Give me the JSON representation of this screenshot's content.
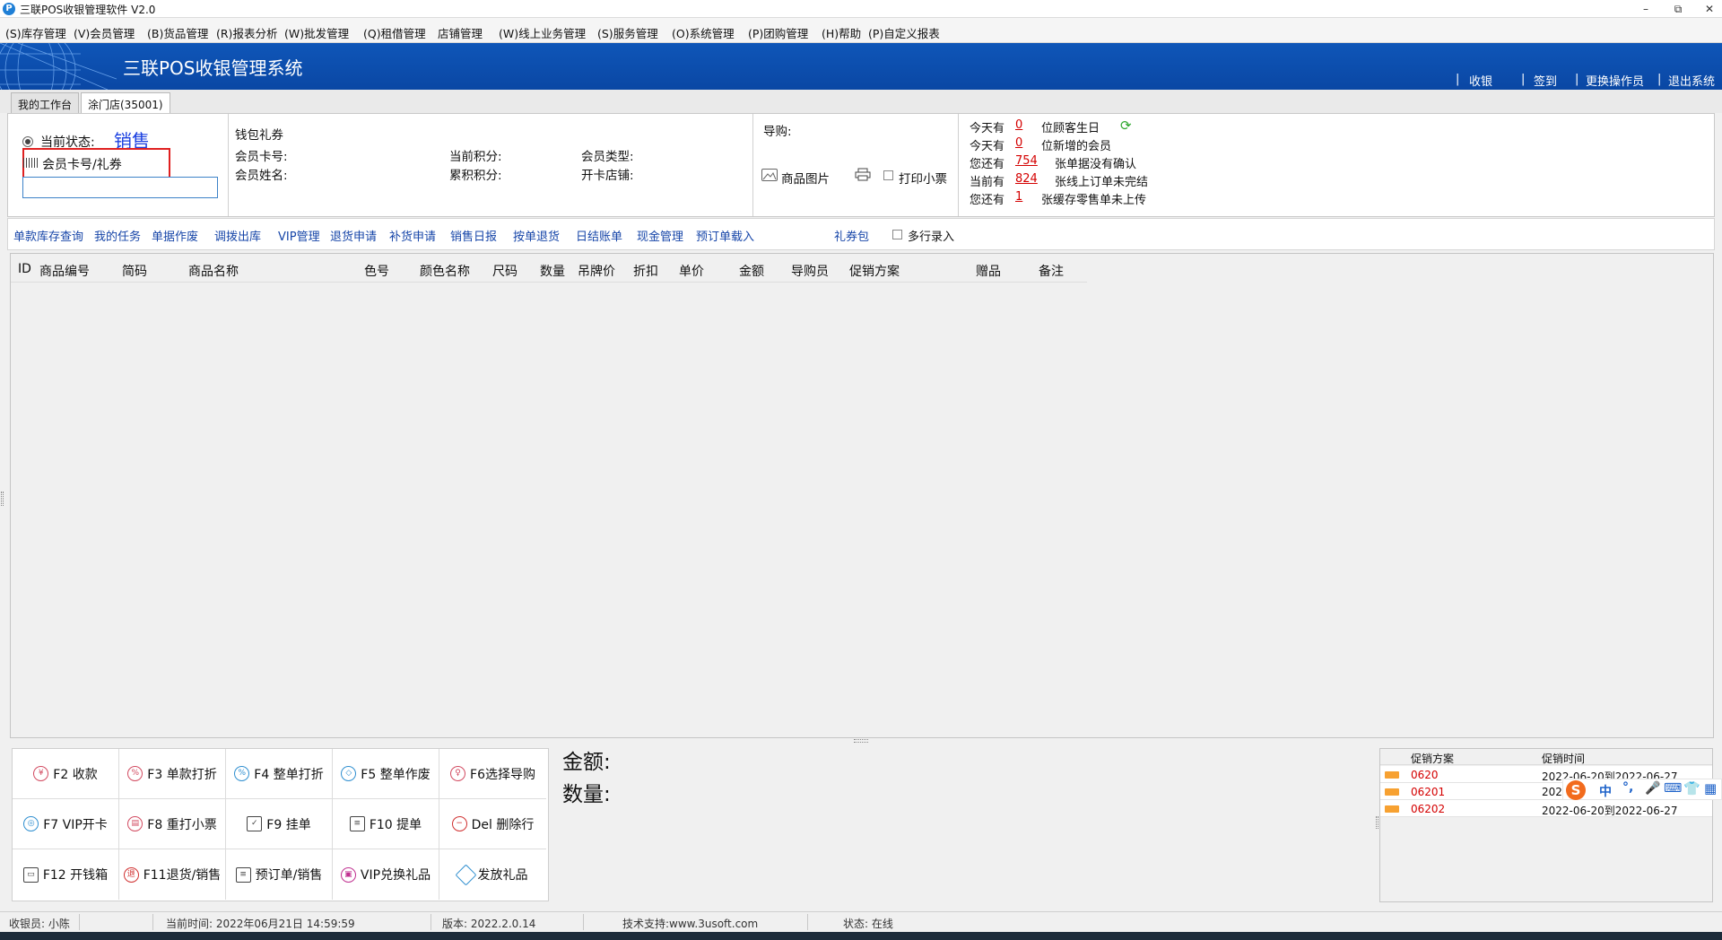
{
  "window": {
    "title": "三联POS收银管理软件 V2.0",
    "logo": "P"
  },
  "menu": [
    "(S)库存管理",
    "(V)会员管理",
    "(B)货品管理",
    "(R)报表分析",
    "(W)批发管理",
    "(Q)租借管理",
    "店铺管理",
    "(W)线上业务管理",
    "(S)服务管理",
    "(O)系统管理",
    "(P)团购管理",
    "(H)帮助",
    "(P)自定义报表"
  ],
  "banner": {
    "title": "三联POS收银管理系统",
    "links": [
      "收银",
      "签到",
      "更换操作员",
      "退出系统"
    ]
  },
  "tabs": [
    "我的工作台",
    "涂门店(35001)"
  ],
  "status_panel": {
    "state_label": "当前状态:",
    "state_value": "销售",
    "card_label": "会员卡号/礼券",
    "card_value": ""
  },
  "member_panel": {
    "wallet": "钱包礼券",
    "card_no": "会员卡号:",
    "name": "会员姓名:",
    "cur_points": "当前积分:",
    "acc_points": "累积积分:",
    "member_type": "会员类型:",
    "open_store": "开卡店铺:"
  },
  "guide_panel": {
    "guide_label": "导购:",
    "product_image": "商品图片",
    "print_receipt": "打印小票"
  },
  "notices": [
    {
      "prefix": "今天有",
      "count": "0",
      "suffix": "位顾客生日"
    },
    {
      "prefix": "今天有",
      "count": "0",
      "suffix": "位新增的会员"
    },
    {
      "prefix": "您还有",
      "count": "754",
      "suffix": "张单据没有确认"
    },
    {
      "prefix": "当前有",
      "count": "824",
      "suffix": "张线上订单未完结"
    },
    {
      "prefix": "您还有",
      "count": "1",
      "suffix": "张缓存零售单未上传"
    }
  ],
  "function_links": [
    "单款库存查询",
    "我的任务",
    "单据作废",
    "调拨出库",
    "VIP管理",
    "退货申请",
    "补货申请",
    "销售日报",
    "按单退货",
    "日结账单",
    "现金管理",
    "预订单载入"
  ],
  "gift_pack": "礼券包",
  "multi_line": "多行录入",
  "grid_columns": [
    "ID",
    "商品编号",
    "简码",
    "商品名称",
    "色号",
    "颜色名称",
    "尺码",
    "数量",
    "吊牌价",
    "折扣",
    "单价",
    "金额",
    "导购员",
    "促销方案",
    "赠品",
    "备注"
  ],
  "fkeys": [
    "F2 收款",
    "F3 单款打折",
    "F4 整单打折",
    "F5 整单作废",
    "F6选择导购",
    "F7 VIP开卡",
    "F8 重打小票",
    "F9 挂单",
    "F10 提单",
    "Del 删除行",
    "F12 开钱箱",
    "F11退货/销售",
    "预订单/销售",
    "VIP兑换礼品",
    "发放礼品"
  ],
  "totals": {
    "amount_label": "金额:",
    "qty_label": "数量:"
  },
  "promo": {
    "headers": [
      "促销方案",
      "促销时间"
    ],
    "rows": [
      {
        "code": "0620",
        "time": "2022-06-20到2022-06-27"
      },
      {
        "code": "06201",
        "time": "2022"
      },
      {
        "code": "06202",
        "time": "2022-06-20到2022-06-27"
      }
    ]
  },
  "ime": {
    "lang": "中"
  },
  "statusbar": {
    "cashier": "收银员: 小陈",
    "time": "当前时间: 2022年06月21日 14:59:59",
    "version": "版本: 2022.2.0.14",
    "support": "技术支持:www.3usoft.com",
    "state": "状态: 在线"
  },
  "colors": {
    "banner": "#0f56b8",
    "link": "#1645a8",
    "alert": "#d40000",
    "state": "#1a3fe0"
  }
}
